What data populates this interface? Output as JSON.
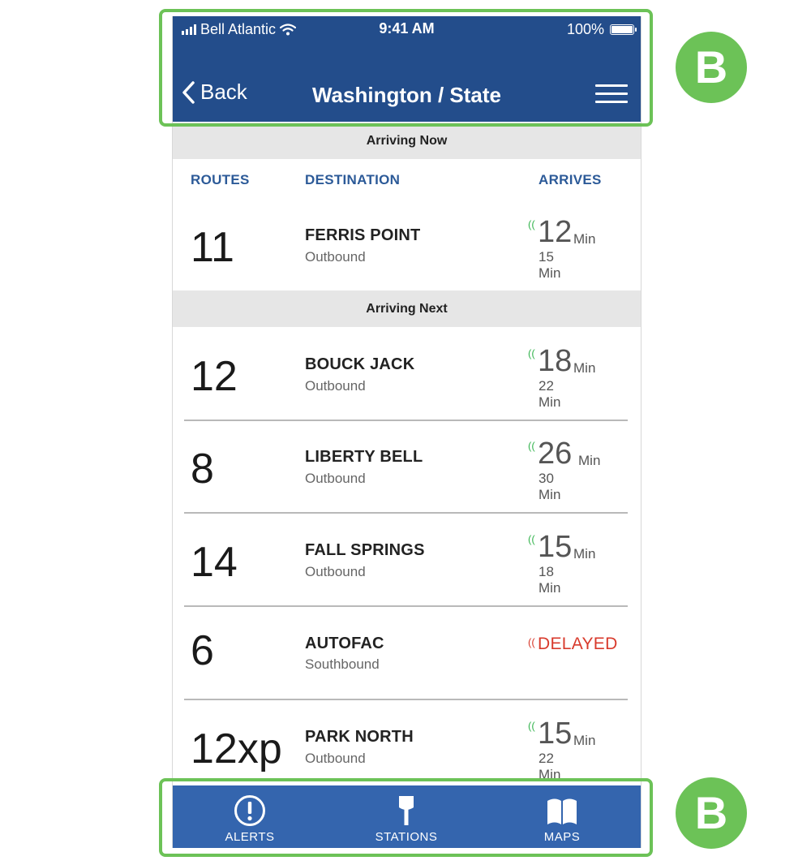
{
  "status_bar": {
    "carrier": "Bell Atlantic",
    "time": "9:41 AM",
    "battery": "100%"
  },
  "header": {
    "back_label": "Back",
    "title": "Washington / State"
  },
  "sections": {
    "now": "Arriving Now",
    "next": "Arriving Next"
  },
  "columns": {
    "routes": "ROUTES",
    "destination": "DESTINATION",
    "arrives": "ARRIVES"
  },
  "arriving_now": [
    {
      "route": "11",
      "destination": "FERRIS POINT",
      "direction": "Outbound",
      "arrives": "12",
      "unit": "Min",
      "next": "15 Min"
    }
  ],
  "arriving_next": [
    {
      "route": "12",
      "destination": "BOUCK JACK",
      "direction": "Outbound",
      "arrives": "18",
      "unit": "Min",
      "next": "22 Min"
    },
    {
      "route": "8",
      "destination": "LIBERTY BELL",
      "direction": "Outbound",
      "arrives": "26",
      "unit": "Min",
      "next": "30 Min"
    },
    {
      "route": "14",
      "destination": "FALL SPRINGS",
      "direction": "Outbound",
      "arrives": "15",
      "unit": "Min",
      "next": "18 Min"
    },
    {
      "route": "6",
      "destination": "AUTOFAC",
      "direction": "Southbound",
      "status": "DELAYED"
    },
    {
      "route": "12xp",
      "destination": "PARK NORTH",
      "direction": "Outbound",
      "arrives": "15",
      "unit": "Min",
      "next": "22 Min"
    }
  ],
  "tabbar": {
    "alerts": {
      "label": "ALERTS",
      "icon": "alert-circle-icon"
    },
    "stations": {
      "label": "STATIONS",
      "icon": "bus-stop-sign-icon"
    },
    "maps": {
      "label": "MAPS",
      "icon": "book-map-icon"
    }
  },
  "annotations": {
    "top_badge": "B",
    "bottom_badge": "B"
  },
  "colors": {
    "header_bg": "#234d8b",
    "tabbar_bg": "#3465ae",
    "column_head": "#2c5a98",
    "realtime_signal": "#39b552",
    "delayed": "#d83a2c",
    "annotation": "#6cc257"
  }
}
